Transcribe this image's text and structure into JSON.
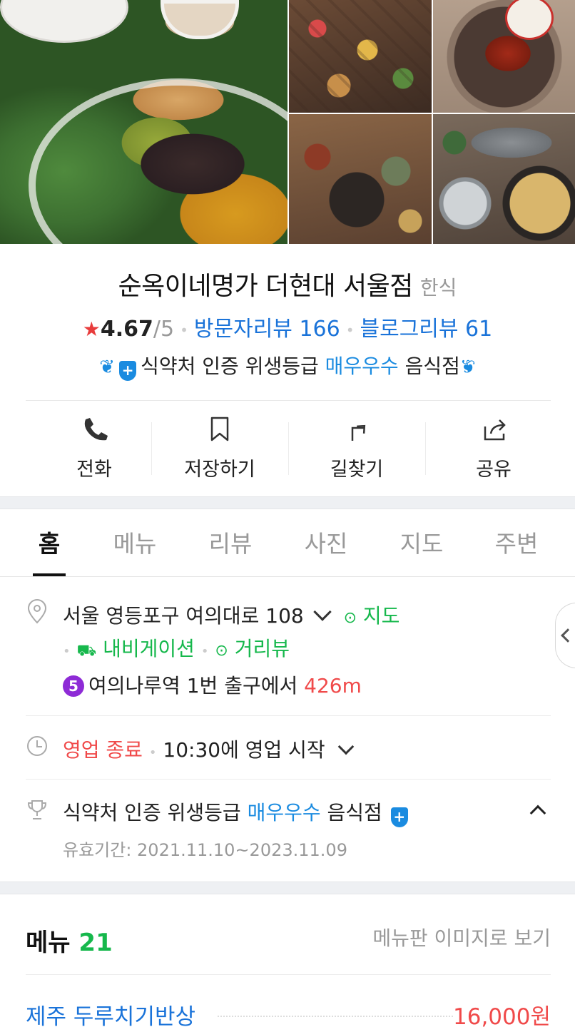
{
  "place": {
    "name": "순옥이네명가 더현대 서울점",
    "category": "한식",
    "rating_score": "4.67",
    "rating_max": "/5",
    "visitor_reviews": "방문자리뷰 166",
    "blog_reviews": "블로그리뷰 61",
    "cert_prefix": "식약처 인증 위생등급",
    "cert_grade": "매우우수",
    "cert_suffix": "음식점"
  },
  "actions": [
    {
      "label": "전화",
      "icon": "phone-icon"
    },
    {
      "label": "저장하기",
      "icon": "bookmark-icon"
    },
    {
      "label": "길찾기",
      "icon": "directions-icon"
    },
    {
      "label": "공유",
      "icon": "share-icon"
    }
  ],
  "tabs": [
    "홈",
    "메뉴",
    "리뷰",
    "사진",
    "지도",
    "주변"
  ],
  "active_tab": "홈",
  "info": {
    "address": "서울 영등포구 여의대로 108",
    "map_link": "지도",
    "navi_link": "내비게이션",
    "street_link": "거리뷰",
    "subway_line": "5",
    "subway_station": "여의나루역",
    "subway_exit": "1번 출구에서",
    "subway_distance": "426m",
    "hours_status": "영업 종료",
    "hours_next": "10:30에 영업 시작",
    "cert_prefix": "식약처 인증 위생등급",
    "cert_grade": "매우우수",
    "cert_suffix": "음식점",
    "cert_period": "유효기간: 2021.11.10~2023.11.09"
  },
  "menu": {
    "title": "메뉴",
    "count": "21",
    "view_board": "메뉴판 이미지로 보기",
    "items": [
      {
        "name": "제주 두루치기반상",
        "price": "16,000원"
      }
    ]
  },
  "colors": {
    "accent_blue": "#1a8be0",
    "link_blue": "#1a73d9",
    "green": "#16b84c",
    "red": "#f04a4a",
    "subway_line5": "#8e2bd6"
  }
}
